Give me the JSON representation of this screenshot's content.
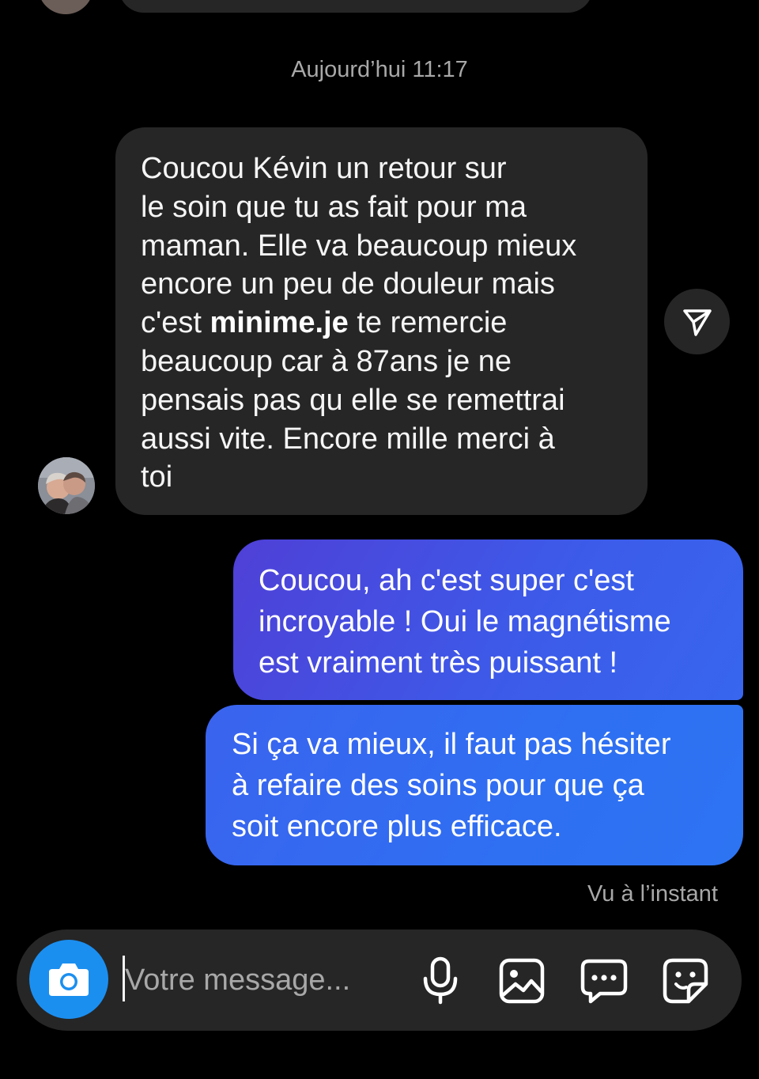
{
  "thread": {
    "timestamp": "Aujourd’hui 11:17",
    "incoming_message": {
      "text_before_bold": "Coucou Kévin un retour sur\nle soin que tu as fait pour ma\nmaman. Elle va beaucoup mieux\nencore un peu de douleur mais\nc'est ",
      "bold_text": "minime.je",
      "text_after_bold": " te remercie\nbeaucoup car à 87ans je ne\npensais pas qu elle se remettrai\naussi vite. Encore mille merci à\ntoi"
    },
    "outgoing_messages": [
      {
        "text": "Coucou, ah c'est super c'est\nincroyable ! Oui le magnétisme\nest vraiment très puissant !"
      },
      {
        "text": "Si ça va mieux, il faut pas hésiter\nà refaire des soins pour que ça\nsoit encore plus efficace."
      }
    ],
    "seen_status": "Vu à l’instant"
  },
  "composer": {
    "placeholder": "Votre message...",
    "icons": [
      "camera-icon",
      "microphone-icon",
      "gallery-icon",
      "chat-bubble-icon",
      "sticker-icon"
    ]
  },
  "colors": {
    "background": "#000000",
    "incoming_bubble": "#262626",
    "outgoing_gradient_start": "#4f40d7",
    "outgoing_gradient_end": "#2d74f3",
    "camera_button": "#1b8ff0",
    "secondary_text": "#a8a8a8"
  }
}
